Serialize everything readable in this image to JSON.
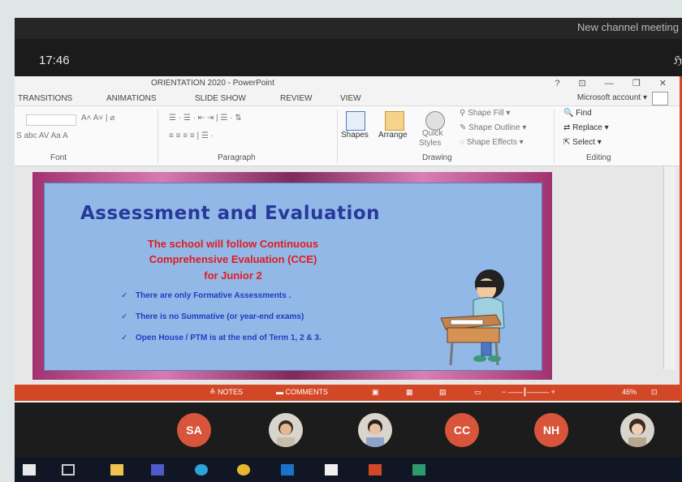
{
  "meeting": {
    "title": "New channel meeting",
    "clock": "17:46",
    "people_icon": "people-icon"
  },
  "powerpoint": {
    "doc_title": "ORIENTATION 2020 - PowerPoint",
    "window_controls": "? ⊡ — ❐ ✕",
    "tabs": [
      "TRANSITIONS",
      "ANIMATIONS",
      "SLIDE SHOW",
      "REVIEW",
      "VIEW"
    ],
    "account": "Microsoft account",
    "ribbon": {
      "font_group": "Font",
      "paragraph_group": "Paragraph",
      "drawing_group": "Drawing",
      "editing_group": "Editing",
      "shapes": "Shapes",
      "arrange": "Arrange",
      "quick_styles_1": "Quick",
      "quick_styles_2": "Styles",
      "shape_fill": "Shape Fill",
      "shape_outline": "Shape Outline",
      "shape_effects": "Shape Effects",
      "find": "Find",
      "replace": "Replace",
      "select": "Select",
      "font_row2": "S abc AV Aa A"
    },
    "slide": {
      "title": "Assessment and Evaluation",
      "subtitle_1": "The school will follow Continuous",
      "subtitle_2": "Comprehensive Evaluation (CCE)",
      "subtitle_3": "for Junior 2",
      "bullets": [
        "There are only Formative Assessments .",
        "There is no Summative (or year-end exams)",
        "Open House / PTM  is at the end of Term 1, 2 & 3."
      ]
    },
    "status": {
      "notes": "NOTES",
      "comments": "COMMENTS",
      "zoom": "46%"
    }
  },
  "participants": [
    {
      "label": "SA",
      "color": "#d8553b"
    },
    {
      "label": "",
      "color": "#c9c2b6",
      "photo": true
    },
    {
      "label": "",
      "color": "#c9c2b6",
      "photo": true
    },
    {
      "label": "CC",
      "color": "#d8553b"
    },
    {
      "label": "NH",
      "color": "#d8553b"
    },
    {
      "label": "",
      "color": "#c9c2b6",
      "photo": true
    }
  ],
  "taskbar_icons": [
    "start-icon",
    "task-view-icon",
    "file-explorer-icon",
    "teams-icon",
    "edge-icon",
    "chrome-icon",
    "outlook-icon",
    "notepad-icon",
    "powerpoint-icon",
    "app-icon"
  ]
}
